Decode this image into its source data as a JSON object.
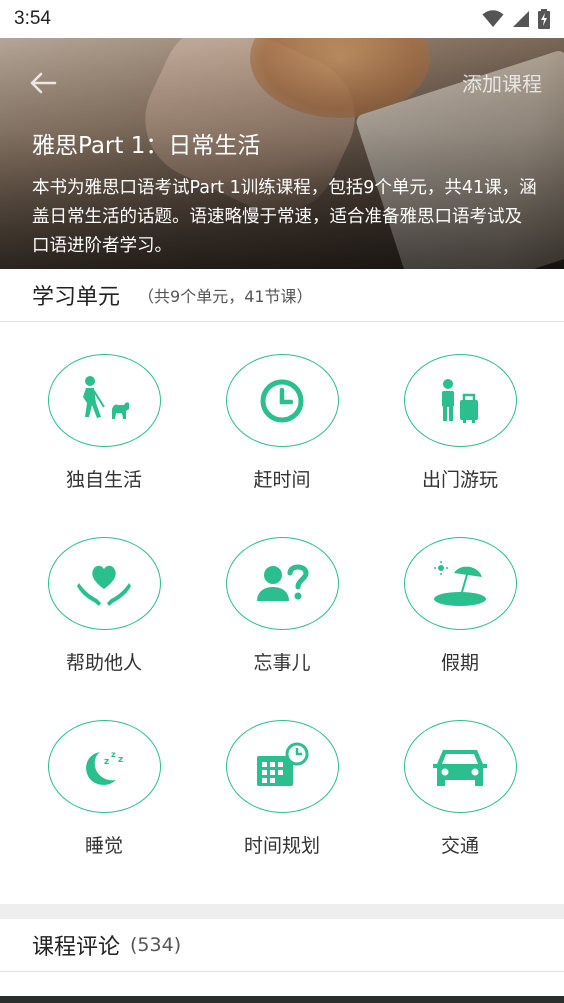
{
  "status_bar": {
    "time": "3:54"
  },
  "header": {
    "add_course_label": "添加课程",
    "title": "雅思Part 1：日常生活",
    "description": "本书为雅思口语考试Part 1训练课程，包括9个单元，共41课，涵盖日常生活的话题。语速略慢于常速，适合准备雅思口语考试及口语进阶者学习。"
  },
  "units_section": {
    "title": "学习单元",
    "subtitle": "（共9个单元，41节课）",
    "units": [
      {
        "label": "独自生活",
        "icon": "walking-dog-icon"
      },
      {
        "label": "赶时间",
        "icon": "clock-icon"
      },
      {
        "label": "出门游玩",
        "icon": "traveler-luggage-icon"
      },
      {
        "label": "帮助他人",
        "icon": "heart-hands-icon"
      },
      {
        "label": "忘事儿",
        "icon": "person-question-icon"
      },
      {
        "label": "假期",
        "icon": "beach-umbrella-icon"
      },
      {
        "label": "睡觉",
        "icon": "moon-sleep-icon"
      },
      {
        "label": "时间规划",
        "icon": "calendar-clock-icon"
      },
      {
        "label": "交通",
        "icon": "car-icon"
      }
    ]
  },
  "reviews": {
    "title": "课程评论",
    "count": "(534)"
  },
  "colors": {
    "accent": "#2bbf8e",
    "hero_text": "#ffffff",
    "divider": "#e4e4e4"
  }
}
